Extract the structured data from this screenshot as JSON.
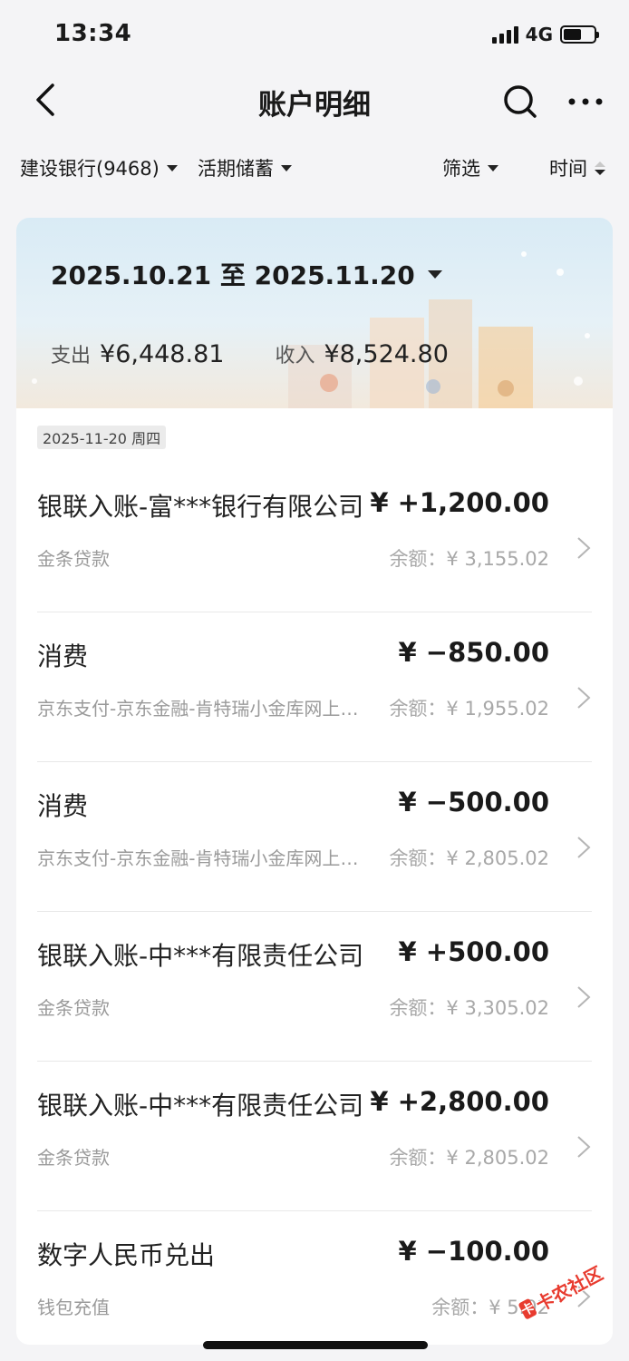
{
  "status_bar": {
    "time": "13:34",
    "network": "4G"
  },
  "nav": {
    "title": "账户明细",
    "icons": [
      "back-chevron-icon",
      "search-icon",
      "more-icon"
    ]
  },
  "filters": {
    "bank": "建设银行(9468)",
    "account_type": "活期储蓄",
    "filter": "筛选",
    "sort": "时间"
  },
  "summary": {
    "period": "2025.10.21 至 2025.11.20",
    "expense_label": "支出",
    "expense_value": "¥6,448.81",
    "income_label": "收入",
    "income_value": "¥8,524.80"
  },
  "date_group": "2025-11-20 周四",
  "transactions": [
    {
      "title": "银联入账-富***银行有限公司",
      "amount": "¥ +1,200.00",
      "subtitle": "金条贷款",
      "balance": "余额：¥ 3,155.02"
    },
    {
      "title": "消费",
      "amount": "¥ −850.00",
      "subtitle": "京东支付-京东金融-肯特瑞小金库网上支付",
      "balance": "余额：¥ 1,955.02"
    },
    {
      "title": "消费",
      "amount": "¥ −500.00",
      "subtitle": "京东支付-京东金融-肯特瑞小金库网上支付",
      "balance": "余额：¥ 2,805.02"
    },
    {
      "title": "银联入账-中***有限责任公司",
      "amount": "¥ +500.00",
      "subtitle": "金条贷款",
      "balance": "余额：¥ 3,305.02"
    },
    {
      "title": "银联入账-中***有限责任公司",
      "amount": "¥ +2,800.00",
      "subtitle": "金条贷款",
      "balance": "余额：¥ 2,805.02"
    },
    {
      "title": "数字人民币兑出",
      "amount": "¥ −100.00",
      "subtitle": "钱包充值",
      "balance": "余额：¥ 5.02"
    }
  ],
  "watermark": {
    "text": "卡农社区",
    "logo": "卡"
  },
  "colors": {
    "background": "#f4f4f6",
    "card": "#ffffff",
    "banner_top": "#d9ebf5",
    "watermark": "#e83b2f"
  }
}
